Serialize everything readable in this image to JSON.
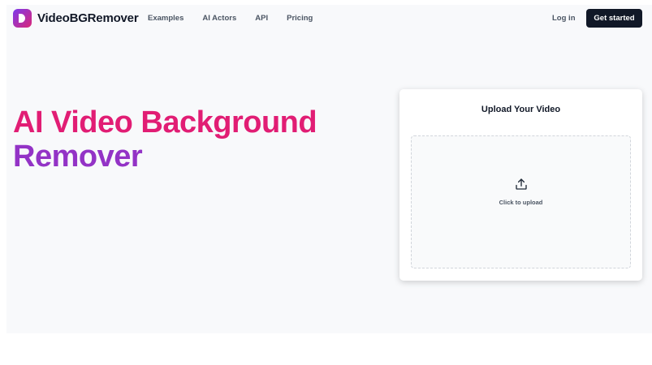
{
  "header": {
    "brand": "VideoBGRemover",
    "nav": [
      "Examples",
      "AI Actors",
      "API",
      "Pricing"
    ],
    "login": "Log in",
    "cta": "Get started"
  },
  "hero": {
    "line1": "AI Video Background",
    "line2": "Remover"
  },
  "upload": {
    "title": "Upload Your Video",
    "label": "Click to upload",
    "icon": "upload-icon"
  },
  "colors": {
    "accent_pink": "#e11d74",
    "accent_purple": "#9333c6",
    "cta_bg": "#111827"
  }
}
